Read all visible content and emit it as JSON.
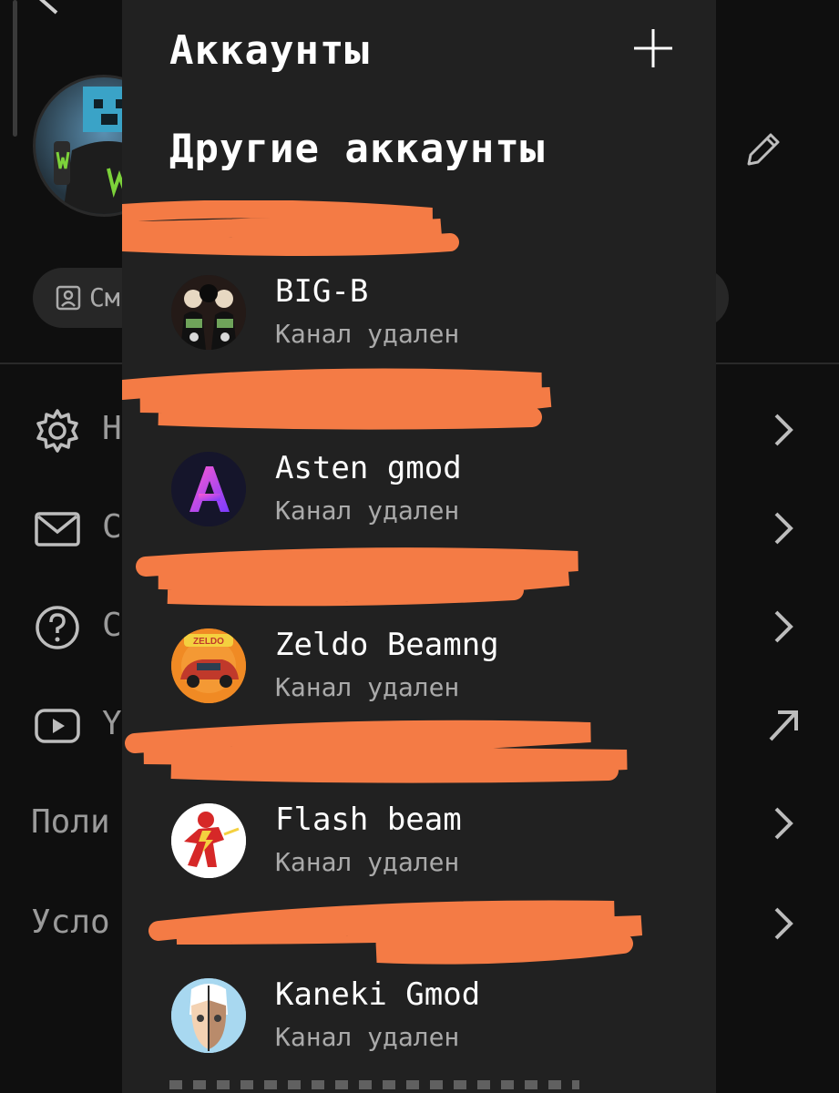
{
  "background": {
    "manage_label": "См",
    "rows": [
      {
        "label": "Н"
      },
      {
        "label": "С"
      },
      {
        "label": "С"
      },
      {
        "label": "Y"
      },
      {
        "label": "Поли"
      },
      {
        "label": "Усло"
      }
    ]
  },
  "panel": {
    "title": "Аккаунты",
    "section_title": "Другие аккаунты",
    "accounts": [
      {
        "name": "BIG-B",
        "status": "Канал удален",
        "avatar_icon": "masked-figures-avatar"
      },
      {
        "name": "Asten gmod",
        "status": "Канал удален",
        "avatar_icon": "letter-a-avatar"
      },
      {
        "name": "Zeldo Beamng",
        "status": "Канал удален",
        "avatar_icon": "orange-car-avatar"
      },
      {
        "name": "Flash beam",
        "status": "Канал удален",
        "avatar_icon": "flash-hero-avatar"
      },
      {
        "name": "Kaneki Gmod",
        "status": "Канал удален",
        "avatar_icon": "split-face-avatar"
      }
    ]
  },
  "colors": {
    "panel_bg": "#212121",
    "page_bg": "#0f0f0f",
    "redaction": "#f47b45",
    "muted_text": "#aaaaaa"
  }
}
